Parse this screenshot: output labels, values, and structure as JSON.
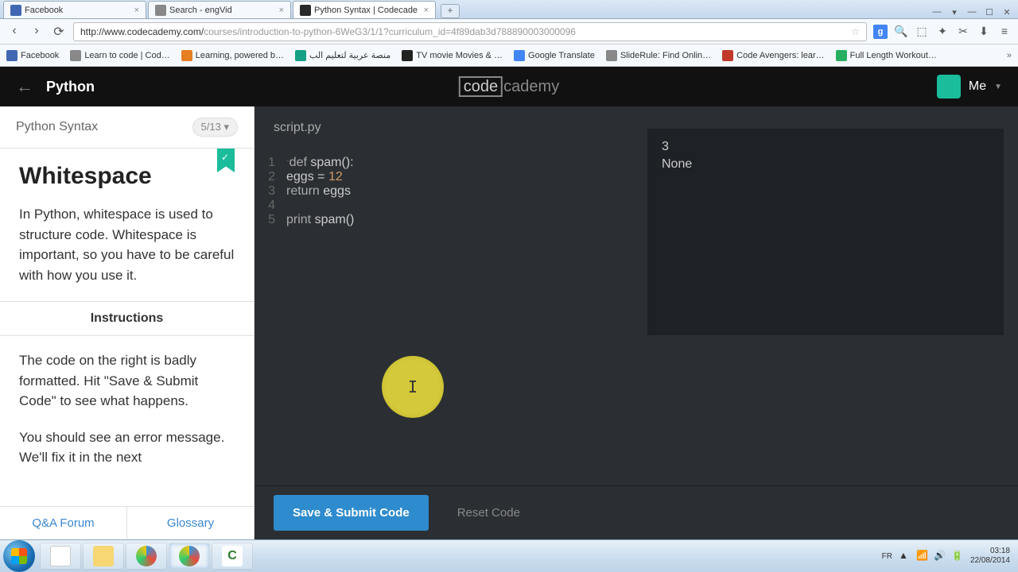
{
  "browser": {
    "tabs": [
      {
        "label": "Facebook"
      },
      {
        "label": "Search - engVid"
      },
      {
        "label": "Python Syntax | Codecade"
      }
    ],
    "url_host": "http://www.codecademy.com/",
    "url_path": "courses/introduction-to-python-6WeG3/1/1?curriculum_id=4f89dab3d788890003000096",
    "bookmarks": [
      "Facebook",
      "Learn to code | Cod…",
      "Learning, powered b…",
      "منصة عربية لتعليم الب",
      "TV movie Movies & …",
      "Google Translate",
      "SlideRule: Find Onlin…",
      "Code Avengers: lear…",
      "Full Length Workout…"
    ]
  },
  "header": {
    "course": "Python",
    "logo_a": "code",
    "logo_b": "cademy",
    "me": "Me"
  },
  "sidebar": {
    "section": "Python Syntax",
    "progress": "5/13 ▾",
    "title": "Whitespace",
    "p1": "In Python, whitespace is used to structure code. Whitespace is important, so you have to be careful with how you use it.",
    "instructions_label": "Instructions",
    "p2": "The code on the right is badly formatted. Hit \"Save & Submit Code\" to see what happens.",
    "p3": "You should see an error message. We'll fix it in the next",
    "qa": "Q&A Forum",
    "glossary": "Glossary"
  },
  "editor": {
    "filename": "script.py",
    "lines": [
      {
        "n": "1",
        "fold": "-",
        "html": "def spam():"
      },
      {
        "n": "2",
        "fold": "",
        "html": "eggs = 12"
      },
      {
        "n": "3",
        "fold": "",
        "html": "return eggs"
      },
      {
        "n": "4",
        "fold": "",
        "html": ""
      },
      {
        "n": "5",
        "fold": "",
        "html": "print spam()"
      }
    ],
    "console": [
      "3",
      "None"
    ],
    "save": "Save & Submit Code",
    "reset": "Reset Code"
  },
  "taskbar": {
    "lang": "FR",
    "time": "03:18",
    "date": "22/08/2014"
  }
}
